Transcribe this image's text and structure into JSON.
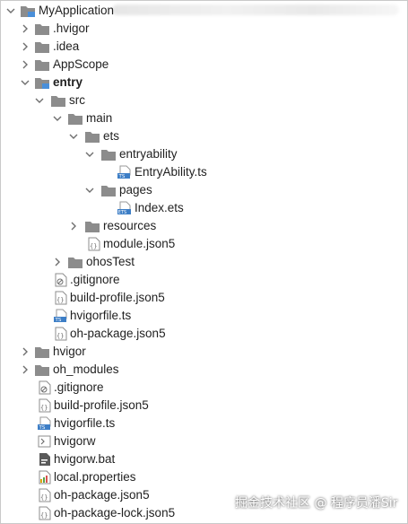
{
  "tree": {
    "root_label": "MyApplication",
    "items": [
      {
        "label": ".hvigor",
        "bold": false
      },
      {
        "label": ".idea",
        "bold": false
      },
      {
        "label": "AppScope",
        "bold": false
      },
      {
        "label": "entry",
        "bold": true
      },
      {
        "label": "src",
        "bold": false
      },
      {
        "label": "main",
        "bold": false
      },
      {
        "label": "ets",
        "bold": false
      },
      {
        "label": "entryability",
        "bold": false
      },
      {
        "label": "EntryAbility.ts",
        "bold": false
      },
      {
        "label": "pages",
        "bold": false
      },
      {
        "label": "Index.ets",
        "bold": false
      },
      {
        "label": "resources",
        "bold": false
      },
      {
        "label": "module.json5",
        "bold": false
      },
      {
        "label": "ohosTest",
        "bold": false
      },
      {
        "label": ".gitignore",
        "bold": false
      },
      {
        "label": "build-profile.json5",
        "bold": false
      },
      {
        "label": "hvigorfile.ts",
        "bold": false
      },
      {
        "label": "oh-package.json5",
        "bold": false
      },
      {
        "label": "hvigor",
        "bold": false
      },
      {
        "label": "oh_modules",
        "bold": false
      },
      {
        "label": ".gitignore",
        "bold": false
      },
      {
        "label": "build-profile.json5",
        "bold": false
      },
      {
        "label": "hvigorfile.ts",
        "bold": false
      },
      {
        "label": "hvigorw",
        "bold": false
      },
      {
        "label": "hvigorw.bat",
        "bold": false
      },
      {
        "label": "local.properties",
        "bold": false
      },
      {
        "label": "oh-package.json5",
        "bold": false
      },
      {
        "label": "oh-package-lock.json5",
        "bold": false
      }
    ]
  },
  "icons": {
    "chevron_color": "#6e6e6e",
    "folder_color": "#8c8c8c",
    "module_folder_color": "#8c8c8c",
    "module_badge_color": "#4a8fd9",
    "ts_file_color": "#3d7ec6",
    "ets_file_color": "#3d7ec6",
    "json_file_color": "#8c8c8c",
    "properties_bar_colors": [
      "#e0a800",
      "#5aa14a",
      "#d9534f"
    ]
  },
  "watermark": "掘金技术社区 @ 程序员潘Sir"
}
